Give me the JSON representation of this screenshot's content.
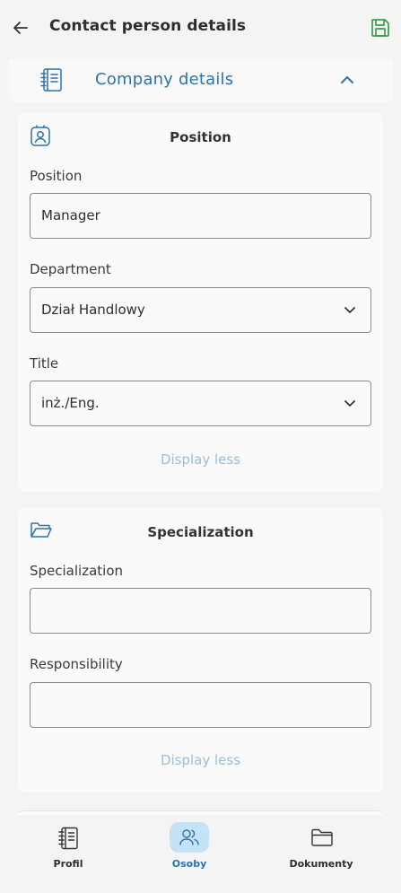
{
  "header": {
    "title": "Contact person details"
  },
  "company_section": {
    "title": "Company details"
  },
  "position_card": {
    "title": "Position",
    "fields": [
      {
        "label": "Position",
        "value": "Manager"
      },
      {
        "label": "Department",
        "value": "Dział Handlowy"
      },
      {
        "label": "Title",
        "value": "inż./Eng."
      }
    ],
    "display_less": "Display less"
  },
  "specialization_card": {
    "title": "Specialization",
    "fields": [
      {
        "label": "Specialization",
        "value": ""
      },
      {
        "label": "Responsibility",
        "value": ""
      }
    ],
    "display_less": "Display less"
  },
  "nav": {
    "items": [
      {
        "label": "Profil",
        "icon": "notebook-icon",
        "active": false
      },
      {
        "label": "Osoby",
        "icon": "people-icon",
        "active": true
      },
      {
        "label": "Dokumenty",
        "icon": "folder-icon",
        "active": false
      }
    ]
  },
  "colors": {
    "accent": "#2d73a8",
    "save_green": "#3b9a4a",
    "active_nav_bg": "#c5e2f6",
    "muted_link": "#9cbdd6"
  }
}
